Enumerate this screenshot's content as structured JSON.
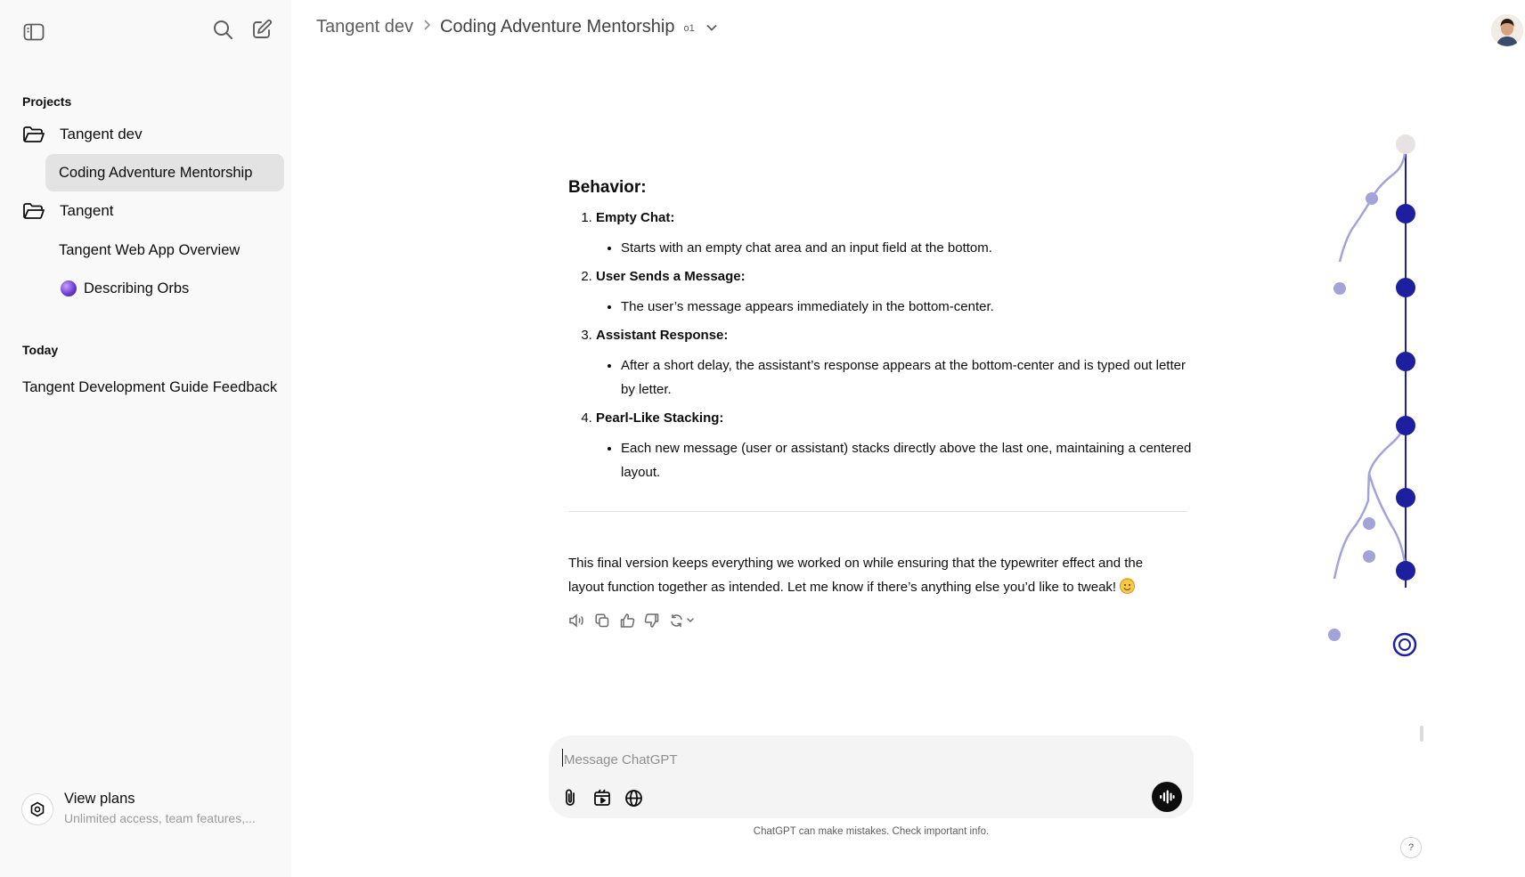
{
  "sidebar": {
    "projects_label": "Projects",
    "projects": [
      {
        "label": "Tangent dev"
      },
      {
        "label": "Tangent"
      }
    ],
    "chats": [
      {
        "label": "Coding Adventure Mentorship"
      },
      {
        "label": "Tangent Web App Overview"
      },
      {
        "label": "Describing Orbs"
      }
    ],
    "today_label": "Today",
    "today": [
      {
        "label": "Tangent Development Guide Feedback"
      }
    ],
    "view_plans": {
      "title": "View plans",
      "subtitle": "Unlimited access, team features,..."
    }
  },
  "header": {
    "project": "Tangent dev",
    "chat_title": "Coding Adventure Mentorship",
    "model": "o1"
  },
  "message": {
    "heading": "Behavior:",
    "steps": [
      {
        "title": "Empty Chat",
        "suffix": ":",
        "bullets": [
          "Starts with an empty chat area and an input field at the bottom."
        ]
      },
      {
        "title": "User Sends a Message",
        "suffix": ":",
        "bullets": [
          "The user’s message appears immediately in the bottom-center."
        ]
      },
      {
        "title": "Assistant Response",
        "suffix": ":",
        "bullets": [
          "After a short delay, the assistant’s response appears at the bottom-center and is typed out letter by letter."
        ]
      },
      {
        "title": "Pearl-Like Stacking",
        "suffix": ":",
        "bullets": [
          "Each new message (user or assistant) stacks directly above the last one, maintaining a centered layout."
        ]
      }
    ],
    "closing": "This final version keeps everything we worked on while ensuring that the typewriter effect and the layout function together as intended. Let me know if there’s anything else you’d like to tweak!"
  },
  "composer": {
    "placeholder": "Message ChatGPT",
    "value": ""
  },
  "disclaimer": "ChatGPT can make mistakes. Check important info.",
  "help": "?",
  "colors": {
    "sidebar_bg": "#f9f9f9",
    "active_chat_bg": "#e3e3e3",
    "tree_main": "#1d1f9e",
    "tree_branch": "#a3a2d9",
    "tree_root": "#e8e2e2",
    "composer_bg": "#f4f4f4"
  },
  "icons": {
    "sidebar_toggle": "sidebar-toggle-icon",
    "search": "search-icon",
    "new_chat": "new-chat-icon",
    "folder": "folder-icon",
    "view_plans": "plans-icon",
    "chevron": "chevron-down-icon",
    "read_aloud": "speaker-icon",
    "copy": "copy-icon",
    "thumbs_up": "thumbs-up-icon",
    "thumbs_down": "thumbs-down-icon",
    "regenerate": "regenerate-icon",
    "attach": "paperclip-icon",
    "canvas": "canvas-icon",
    "web": "globe-icon",
    "voice": "voice-mode-icon"
  }
}
